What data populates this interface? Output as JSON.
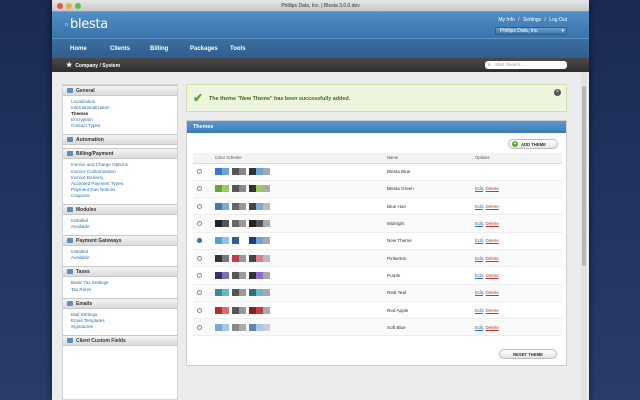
{
  "window": {
    "title": "Phillips Data, Inc. | Blesta 3.0.0.dev"
  },
  "header": {
    "logo": "blesta",
    "links": [
      "My Info",
      "Settings",
      "Log Out"
    ],
    "separator": "/",
    "company": "Phillips Data, Inc."
  },
  "nav": {
    "items": [
      "Home",
      "Clients",
      "Billing",
      "Packages",
      "Tools"
    ]
  },
  "breadcrumb": {
    "text": "Company / System"
  },
  "search": {
    "placeholder": "Start Search..."
  },
  "sidebar": {
    "sections": [
      {
        "title": "General",
        "items": [
          "Localization",
          "Internationalization",
          "Themes",
          "Encryption",
          "Contact Types"
        ]
      },
      {
        "title": "Automation",
        "items": []
      },
      {
        "title": "Billing/Payment",
        "items": [
          "Invoice and Charge Options",
          "Invoice Customization",
          "Invoice Delivery",
          "Accepted Payment Types",
          "Payment Due Notices",
          "Coupons"
        ]
      },
      {
        "title": "Modules",
        "items": [
          "Installed",
          "Available"
        ]
      },
      {
        "title": "Payment Gateways",
        "items": [
          "Installed",
          "Available"
        ]
      },
      {
        "title": "Taxes",
        "items": [
          "Basic Tax Settings",
          "Tax Rules"
        ]
      },
      {
        "title": "Emails",
        "items": [
          "Mail Settings",
          "Email Templates",
          "Signatures"
        ]
      },
      {
        "title": "Client Custom Fields",
        "items": []
      }
    ],
    "active": "Themes"
  },
  "alert": {
    "message": "The theme \"New Theme\" has been successfully added."
  },
  "themes_panel": {
    "title": "Themes",
    "add_label": "ADD THEME",
    "reset_label": "RESET THEME",
    "columns": [
      "Color Scheme",
      "Name",
      "Options"
    ],
    "edit_label": "Edit",
    "delete_label": "Delete",
    "rows": [
      {
        "name": "Blesta Blue",
        "selected": false,
        "has_options": false,
        "colors": [
          "#3a78c2",
          "#6aa3d6",
          "#555555",
          "#888888",
          "#333333",
          "#6aa3d6",
          "#aaaaaa"
        ]
      },
      {
        "name": "Blesta Green",
        "selected": false,
        "has_options": true,
        "colors": [
          "#6aa52c",
          "#9acb5f",
          "#555555",
          "#888888",
          "#333333",
          "#9acb5f",
          "#aaaaaa"
        ]
      },
      {
        "name": "Blue Hue",
        "selected": false,
        "has_options": true,
        "colors": [
          "#3f7bb3",
          "#7ea9d4",
          "#666666",
          "#999999",
          "#444444",
          "#7ea9d4",
          "#bbbbbb"
        ]
      },
      {
        "name": "Midnight",
        "selected": false,
        "has_options": true,
        "colors": [
          "#222222",
          "#555555",
          "#666666",
          "#999999",
          "#222222",
          "#555555",
          "#aaaaaa"
        ]
      },
      {
        "name": "New Theme",
        "selected": true,
        "has_options": true,
        "colors": [
          "#4fa3d8",
          "#8cc5ea",
          "#2a5f9c",
          "#ffffff",
          "#1f3c7a",
          "#6aa3d6",
          "#aaaaaa"
        ]
      },
      {
        "name": "Pinkerton",
        "selected": false,
        "has_options": true,
        "colors": [
          "#333333",
          "#777777",
          "#c0394f",
          "#999999",
          "#444444",
          "#e07a8f",
          "#bbbbbb"
        ]
      },
      {
        "name": "Purple",
        "selected": false,
        "has_options": true,
        "colors": [
          "#3a2f6a",
          "#7a6fb0",
          "#555555",
          "#999999",
          "#333333",
          "#8a6fd0",
          "#aaaaaa"
        ]
      },
      {
        "name": "Real Teal",
        "selected": false,
        "has_options": true,
        "colors": [
          "#3a8a9a",
          "#6ab7c5",
          "#555555",
          "#999999",
          "#2c6f80",
          "#6ab7c5",
          "#aaaaaa"
        ]
      },
      {
        "name": "Red Apple",
        "selected": false,
        "has_options": true,
        "colors": [
          "#b03030",
          "#e06a6a",
          "#555555",
          "#999999",
          "#8a2020",
          "#c04040",
          "#aaaaaa"
        ]
      },
      {
        "name": "Soft Blue",
        "selected": false,
        "has_options": true,
        "colors": [
          "#7aa6cf",
          "#a8c8e6",
          "#888888",
          "#aaaaaa",
          "#5a86af",
          "#a8c8e6",
          "#cccccc"
        ]
      }
    ]
  }
}
